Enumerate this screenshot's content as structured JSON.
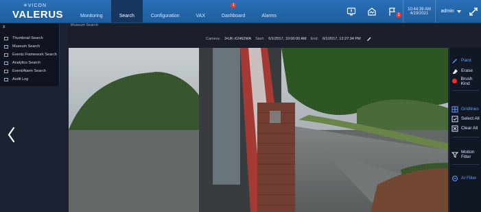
{
  "brand": {
    "sub": "✳VICON",
    "main": "VALERUS"
  },
  "nav": {
    "tabs": [
      {
        "label": "Monitoring",
        "active": false
      },
      {
        "label": "Search",
        "active": true
      },
      {
        "label": "Configuration",
        "active": false
      },
      {
        "label": "VAX",
        "active": false
      },
      {
        "label": "Dashboard",
        "active": false,
        "badge": "1"
      },
      {
        "label": "Alarms",
        "active": false
      }
    ]
  },
  "header": {
    "notification_count": "1",
    "time": "10:44:39 AM",
    "date": "4/19/2021",
    "user": "admin"
  },
  "sidebar_menu": {
    "close_icon": "x",
    "items": [
      {
        "label": "Thumbnail Search"
      },
      {
        "label": "Museum Search"
      },
      {
        "label": "Events Framework Search"
      },
      {
        "label": "Analytics Search"
      },
      {
        "label": "Event/Alarm Search"
      },
      {
        "label": "Audit Log"
      }
    ]
  },
  "breadcrumb": "Museum Search",
  "camera_info": {
    "camera_label": "Camera:",
    "camera_value": "3•UK-X2462WA",
    "start_label": "Start:",
    "start_value": "6/1/2017, 10:00:00 AM",
    "end_label": "End:",
    "end_value": "6/1/2017, 12:27:34 PM"
  },
  "tools": {
    "paint": "Paint",
    "erase": "Erase",
    "brush_kind": "Brush Kind",
    "gridlines": "Gridlines",
    "select_all": "Select All",
    "clear_all": "Clear All",
    "motion_filter": "Motion Filter",
    "ai_filter": "AI Filter"
  },
  "colors": {
    "topbar": "#2a6fb6",
    "accent_blue": "#5fa0ff",
    "brush_red": "#ff2a2a",
    "badge_red": "#e23b3b"
  },
  "icons": {
    "prev": "chevron-left-icon",
    "pencil": "pencil-icon",
    "paint": "paintbrush-icon",
    "erase": "eraser-icon",
    "gridlines": "grid-icon",
    "select_all": "select-all-icon",
    "clear_all": "clear-all-icon",
    "motion_filter": "motion-filter-icon",
    "ai_filter": "ai-filter-icon"
  }
}
